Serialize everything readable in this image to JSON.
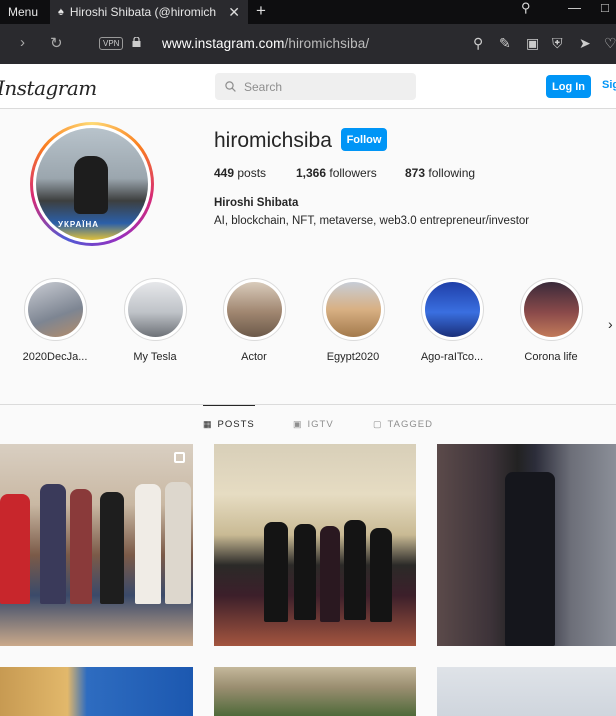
{
  "browser": {
    "menu_label": "Menu",
    "tab_title": "Hiroshi Shibata (@hiromich",
    "url_host": "www.instagram.com",
    "url_path": "/hiromichsiba/",
    "vpn_label": "VPN"
  },
  "header": {
    "logo": "Instagram",
    "search_placeholder": "Search",
    "login_label": "Log In",
    "signup_label": "Sign Up"
  },
  "profile": {
    "username": "hiromichsiba",
    "follow_label": "Follow",
    "posts_count": "449",
    "posts_label": "posts",
    "followers_count": "1,366",
    "followers_label": "followers",
    "following_count": "873",
    "following_label": "following",
    "full_name": "Hiroshi Shibata",
    "bio": "AI, blockchain, NFT, metaverse, web3.0 entrepreneur/investor",
    "avatar_sign_text": "УКРАЇНА"
  },
  "highlights": [
    {
      "label": "2020DecJa...",
      "color": "#8a8f9a"
    },
    {
      "label": "My Tesla",
      "color": "#c9ccd1"
    },
    {
      "label": "Actor",
      "color": "#b39a84"
    },
    {
      "label": "Egypt2020",
      "color": "#c49a6a"
    },
    {
      "label": "Ago-raITco...",
      "color": "#2d59c6"
    },
    {
      "label": "Corona life",
      "color": "#6b3a3a"
    }
  ],
  "tabs": {
    "posts": "POSTS",
    "igtv": "IGTV",
    "tagged": "TAGGED"
  }
}
